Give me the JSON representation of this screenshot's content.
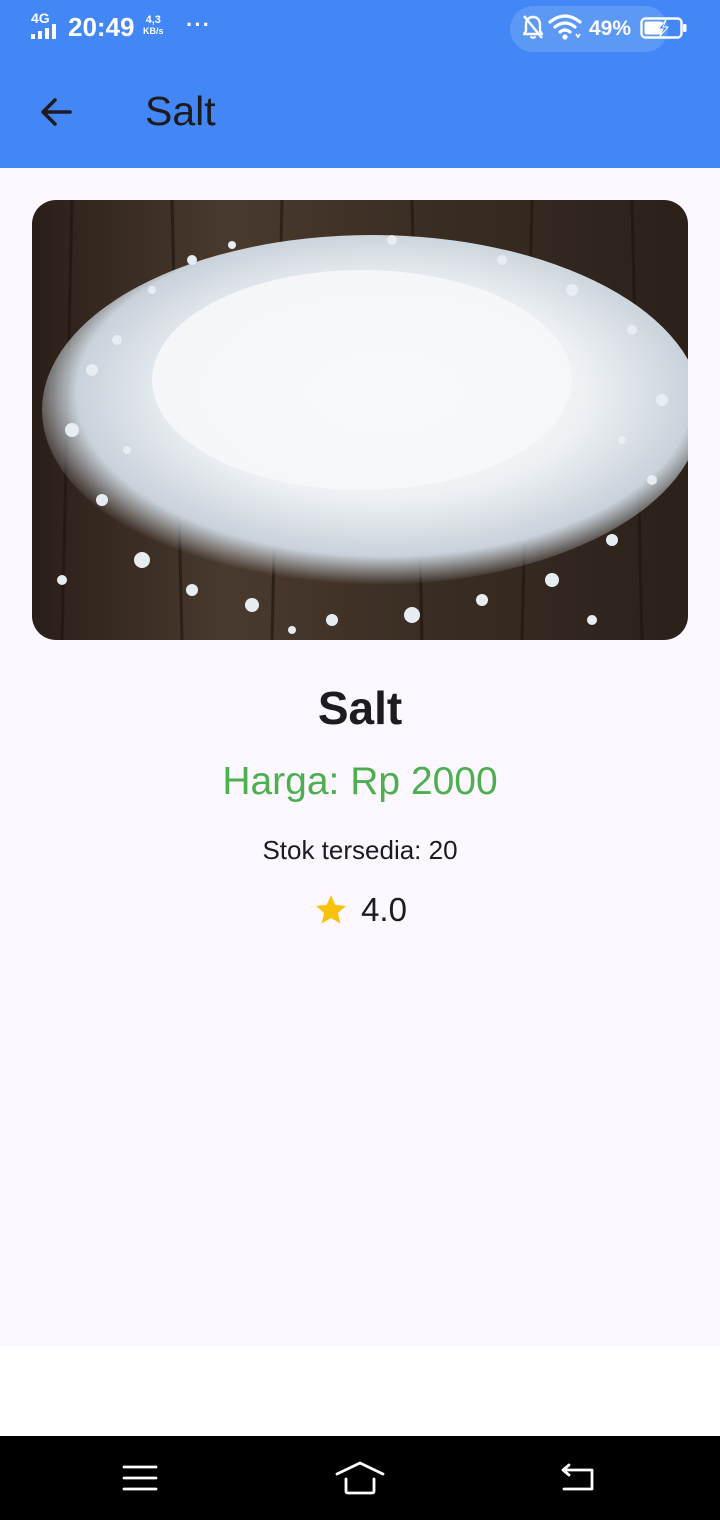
{
  "status_bar": {
    "network": "4G",
    "time": "20:49",
    "speed_value": "4,3",
    "speed_unit": "KB/s",
    "more": "···",
    "battery": "49%",
    "icons": [
      "signal-icon",
      "bell-off-icon",
      "wifi-icon",
      "battery-charging-icon"
    ]
  },
  "app_bar": {
    "back_icon": "arrow-left-icon",
    "title": "Salt"
  },
  "product": {
    "image": "salt-photo",
    "name": "Salt",
    "price": "Harga: Rp 2000",
    "stock": "Stok tersedia: 20",
    "rating_icon": "star-icon",
    "rating": "4.0"
  },
  "nav_bar": {
    "icons": [
      "menu-icon",
      "home-icon",
      "back-icon"
    ]
  },
  "colors": {
    "app_bar": "#4287f5",
    "background": "#fdf7ff",
    "price": "#4caf50",
    "star": "#f9c10b"
  }
}
